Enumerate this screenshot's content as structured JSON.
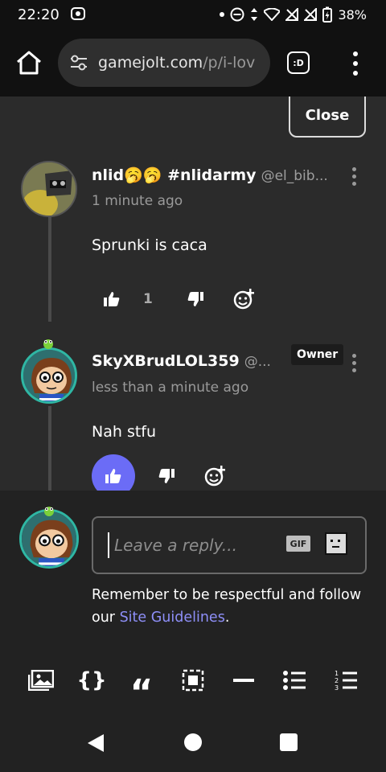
{
  "status": {
    "time": "22:20",
    "battery": "38%",
    "icons": [
      "cast-icon",
      "dot-icon",
      "dnd-icon",
      "data-arrows-icon",
      "wifi-icon",
      "no-signal-icon",
      "no-signal-icon",
      "battery-icon"
    ]
  },
  "browser": {
    "url_host": "gamejolt.com",
    "url_path": "/p/i-lov",
    "tab_badge": ":D",
    "icons": [
      "home-icon",
      "site-settings-icon",
      "tab-switcher-icon",
      "overflow-menu-icon"
    ]
  },
  "panel": {
    "close_label": "Close"
  },
  "comments": [
    {
      "display_name": "nlid🥱🥱 #nlidarmy",
      "handle": "@el_bib...",
      "timestamp": "1 minute ago",
      "body": "Sprunki is caca",
      "like_count": "1"
    },
    {
      "display_name": "SkyXBrudLOL359",
      "handle": "@...",
      "badge": "Owner",
      "timestamp": "less than a minute ago",
      "body": "Nah stfu"
    }
  ],
  "reply": {
    "placeholder": "Leave a reply...",
    "gif_label": "GIF",
    "guidelines_prefix": "Remember to be respectful and follow our ",
    "guidelines_link": "Site Guidelines",
    "guidelines_suffix": "."
  },
  "toolbar": {
    "tools": [
      "image-icon",
      "code-block-icon",
      "quote-icon",
      "embed-icon",
      "horizontal-rule-icon",
      "bullet-list-icon",
      "numbered-list-icon"
    ]
  },
  "colors": {
    "accent": "#6b6cf6",
    "link": "#8e8ff8",
    "avatar_ring": "#2fb7a4"
  }
}
